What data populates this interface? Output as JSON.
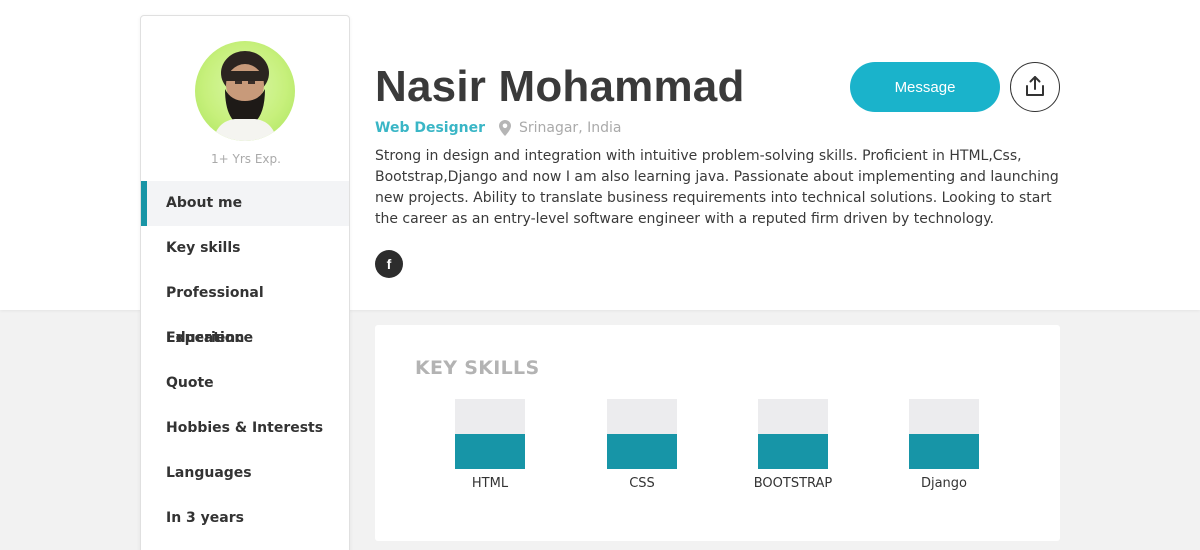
{
  "profile": {
    "name": "Nasir Mohammad",
    "role": "Web Designer",
    "location": "Srinagar, India",
    "experience": "1+ Yrs Exp.",
    "bio": "Strong in design and integration with intuitive problem-solving skills. Proficient in HTML,Css, Bootstrap,Django and now I am also learning java. Passionate about implementing and launching new projects. Ability to translate business requirements into technical solutions. Looking to start the career as an entry-level software engineer with a reputed firm driven by technology.",
    "social_icon": "facebook-icon",
    "social_glyph": "f"
  },
  "actions": {
    "message_label": "Message",
    "share_icon": "share-icon"
  },
  "sidebar": {
    "items": [
      {
        "label": "About me",
        "active": true
      },
      {
        "label": "Key skills"
      },
      {
        "label": "Professional Experience"
      },
      {
        "label": "Education"
      },
      {
        "label": "Quote"
      },
      {
        "label": "Hobbies & Interests"
      },
      {
        "label": "Languages"
      },
      {
        "label": "In 3 years"
      }
    ]
  },
  "skills": {
    "title": "KEY SKILLS",
    "items": [
      {
        "label": "HTML",
        "level": 0.5
      },
      {
        "label": "CSS",
        "level": 0.5
      },
      {
        "label": "BOOTSTRAP",
        "level": 0.5
      },
      {
        "label": "Django",
        "level": 0.5
      }
    ]
  },
  "colors": {
    "accent": "#1ab3cb",
    "skill_fill": "#1795a7",
    "role_text": "#3ab6c6"
  }
}
